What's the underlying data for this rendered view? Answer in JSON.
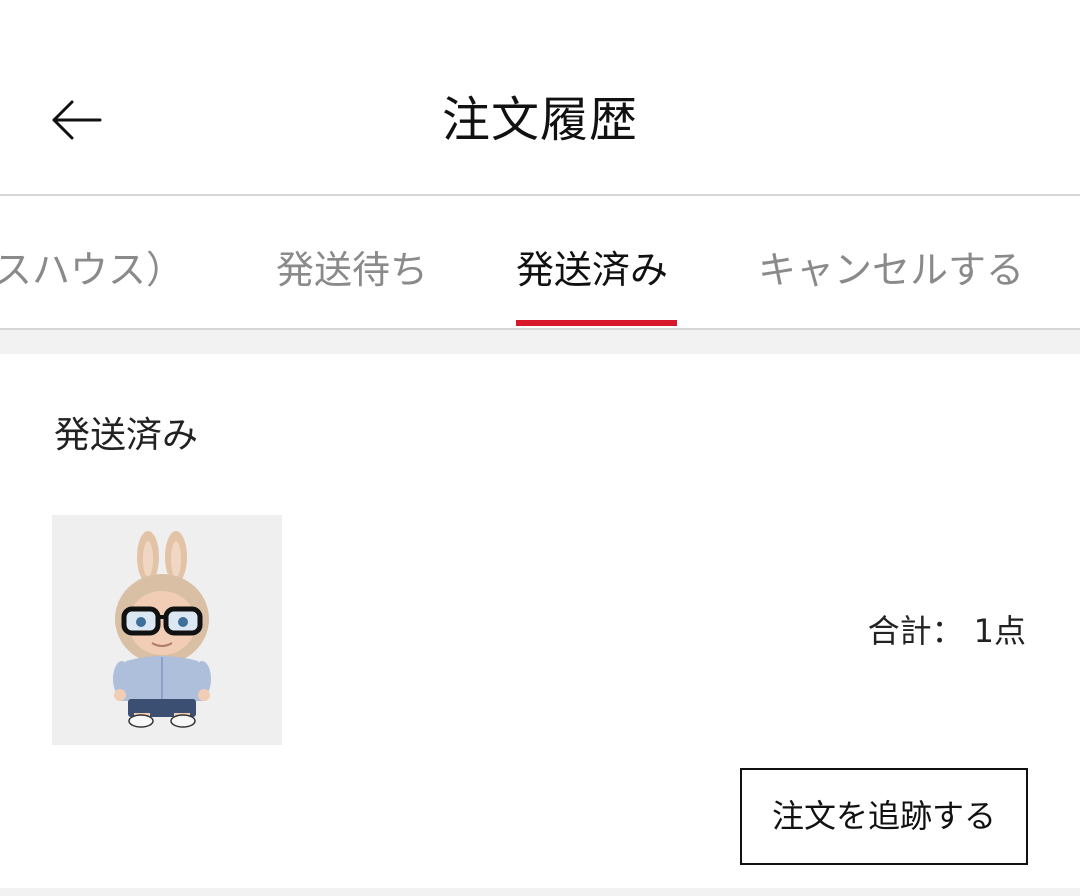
{
  "header": {
    "title": "注文履歴",
    "back_icon": "arrow-left-icon"
  },
  "tabs": [
    {
      "label": "スハウス）",
      "active": false
    },
    {
      "label": "発送待ち",
      "active": false
    },
    {
      "label": "発送済み",
      "active": true
    },
    {
      "label": "キャンセルする",
      "active": false
    }
  ],
  "order": {
    "status": "発送済み",
    "summary_label": "合計：",
    "summary_count": "1点",
    "track_button_label": "注文を追跡する",
    "product_image": "plush-doll-with-glasses"
  },
  "colors": {
    "accent": "#d6182a",
    "inactive_tab": "#8a8a8a",
    "divider": "#d6d6d6",
    "background_gap": "#f2f2f2"
  }
}
